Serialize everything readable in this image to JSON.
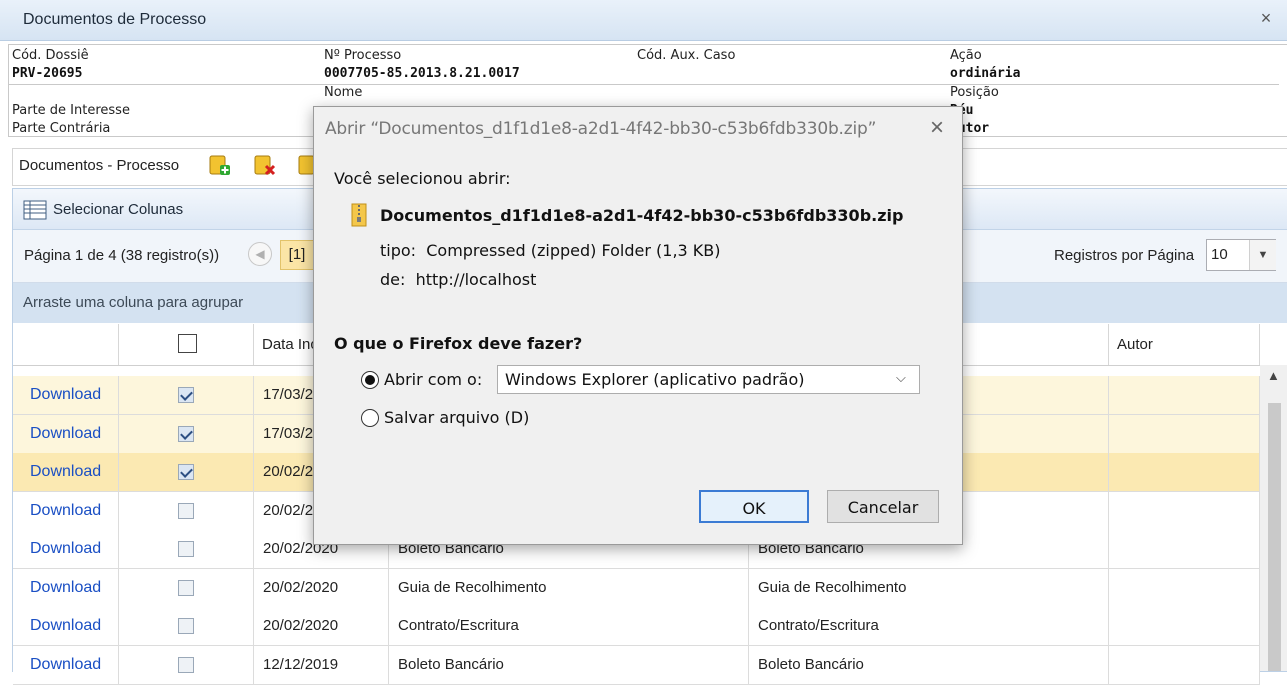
{
  "window": {
    "title": "Documentos de Processo",
    "close_glyph": "×"
  },
  "info": {
    "cod_dossie_label": "Cód. Dossiê",
    "cod_dossie": "PRV-20695",
    "n_processo_label": "Nº Processo",
    "n_processo": "0007705-85.2013.8.21.0017",
    "cod_aux_label": "Cód. Aux. Caso",
    "acao_label": "Ação",
    "acao": "ordinária",
    "nome_label": "Nome",
    "posicao_label": "Posição",
    "parte_interesse_label": "Parte de Interesse",
    "parte_interesse_posicao": "Réu",
    "parte_contraria_label": "Parte Contrária",
    "parte_contraria_posicao": "Autor"
  },
  "docbar": {
    "title": "Documentos - Processo"
  },
  "grid": {
    "select_columns_label": "Selecionar Colunas",
    "page_info": "Página 1 de 4 (38 registro(s))",
    "current_page": "[1]",
    "records_per_page_label": "Registros por Página",
    "records_per_page": "10",
    "group_hint": "Arraste uma coluna para agrupar",
    "columns": [
      "",
      "",
      "Data Inclusão",
      "",
      "",
      "Autor"
    ],
    "rows": [
      {
        "link": "Download",
        "checked": true,
        "date": "17/03/2020",
        "tipo": "",
        "desc": "",
        "autor": "",
        "style": "sel"
      },
      {
        "link": "Download",
        "checked": true,
        "date": "17/03/2020",
        "tipo": "",
        "desc": "",
        "autor": "",
        "style": "sel"
      },
      {
        "link": "Download",
        "checked": true,
        "date": "20/02/2020",
        "tipo": "",
        "desc": "",
        "autor": "",
        "style": "hl"
      },
      {
        "link": "Download",
        "checked": false,
        "date": "20/02/2020",
        "tipo": "",
        "desc": "",
        "autor": "",
        "style": ""
      },
      {
        "link": "Download",
        "checked": false,
        "date": "20/02/2020",
        "tipo": "Boleto Bancário",
        "desc": "Boleto Bancário",
        "autor": "",
        "style": ""
      },
      {
        "link": "Download",
        "checked": false,
        "date": "20/02/2020",
        "tipo": "Guia de Recolhimento",
        "desc": "Guia de Recolhimento",
        "autor": "",
        "style": ""
      },
      {
        "link": "Download",
        "checked": false,
        "date": "20/02/2020",
        "tipo": "Contrato/Escritura",
        "desc": "Contrato/Escritura",
        "autor": "",
        "style": ""
      },
      {
        "link": "Download",
        "checked": false,
        "date": "12/12/2019",
        "tipo": "Boleto Bancário",
        "desc": "Boleto Bancário",
        "autor": "",
        "style": ""
      }
    ]
  },
  "dialog": {
    "title": "Abrir “Documentos_d1f1d1e8-a2d1-4f42-bb30-c53b6fdb330b.zip”",
    "intro": "Você selecionou abrir:",
    "filename": "Documentos_d1f1d1e8-a2d1-4f42-bb30-c53b6fdb330b.zip",
    "type_line": "tipo:  Compressed (zipped) Folder (1,3 KB)",
    "from_line": "de:  http://localhost",
    "question": "O que o Firefox deve fazer?",
    "open_with_label": "Abrir com o:",
    "open_with_app": "Windows Explorer (aplicativo padrão)",
    "save_label": "Salvar arquivo (D)",
    "ok": "OK",
    "cancel": "Cancelar"
  },
  "colors": {
    "accent": "#1a4fc4",
    "selected_row": "#fdf6dc",
    "highlight_row": "#fbe9b2",
    "header_blue": "#d4e2f1"
  }
}
